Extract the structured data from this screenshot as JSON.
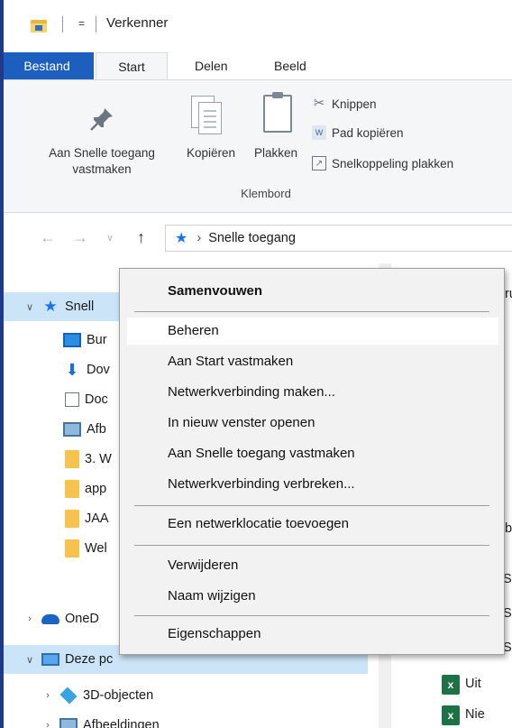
{
  "window": {
    "title": "Verkenner",
    "qa_dropdown": "="
  },
  "tabs": [
    {
      "label": "Bestand"
    },
    {
      "label": "Start"
    },
    {
      "label": "Delen"
    },
    {
      "label": "Beeld"
    }
  ],
  "ribbon": {
    "pin_label_1": "Aan Snelle toegang",
    "pin_label_2": "vastmaken",
    "copy_label": "Kopiëren",
    "paste_label": "Plakken",
    "cut_label": "Knippen",
    "copy_path_label": "Pad kopiëren",
    "paste_shortcut_label": "Snelkoppeling plakken",
    "group_label": "Klembord"
  },
  "address": {
    "path": "Snelle toegang"
  },
  "nav": {
    "items": [
      {
        "label": "Snell",
        "icon": "star-icon"
      },
      {
        "label": "Bur",
        "icon": "desktop-icon"
      },
      {
        "label": "Dov",
        "icon": "download-icon"
      },
      {
        "label": "Doc",
        "icon": "document-icon"
      },
      {
        "label": "Afb",
        "icon": "pictures-icon"
      },
      {
        "label": "3. W",
        "icon": "folder-icon"
      },
      {
        "label": "app",
        "icon": "folder-icon"
      },
      {
        "label": "JAA",
        "icon": "folder-icon"
      },
      {
        "label": "Wel",
        "icon": "folder-icon"
      },
      {
        "label": "OneD",
        "icon": "cloud-icon"
      },
      {
        "label": "Deze pc",
        "icon": "pc-icon"
      },
      {
        "label": "3D-objecten",
        "icon": "cube-icon"
      },
      {
        "label": "Afbeeldingen",
        "icon": "pictures-icon"
      }
    ]
  },
  "content": {
    "fragments": [
      "ru",
      "b",
      "Sa",
      "Sa",
      "S",
      "Uit",
      "Nie"
    ],
    "excel_icon_label": "x"
  },
  "context_menu": {
    "items": [
      "Samenvouwen",
      "Beheren",
      "Aan Start vastmaken",
      "Netwerkverbinding maken...",
      "In nieuw venster openen",
      "Aan Snelle toegang vastmaken",
      "Netwerkverbinding verbreken...",
      "Een netwerklocatie toevoegen",
      "Verwijderen",
      "Naam wijzigen",
      "Eigenschappen"
    ]
  },
  "colors": {
    "file_tab": "#1d5fbf",
    "selection": "#cce4f7",
    "menu_bg": "#f2f2f2"
  }
}
